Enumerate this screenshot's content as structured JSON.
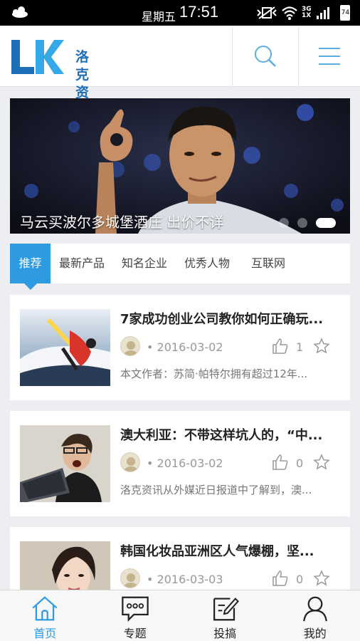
{
  "status_bar": {
    "day": "星期五",
    "time": "17:51",
    "network": [
      "3G",
      "1X"
    ],
    "battery": "74"
  },
  "header": {
    "logo_text": [
      "洛克",
      "资讯"
    ]
  },
  "banner": {
    "caption": "马云买波尔多城堡酒庄 出价不详"
  },
  "tabs": [
    "推荐",
    "最新产品",
    "知名企业",
    "优秀人物",
    "互联网"
  ],
  "articles": [
    {
      "title": "7家成功创业公司教你如何正确玩...",
      "date": "• 2016-03-02",
      "likes": "1",
      "excerpt": "本文作者：苏简·帕特尔拥有超过12年..."
    },
    {
      "title": "澳大利亚：不带这样坑人的，“中...",
      "date": "• 2016-03-02",
      "likes": "0",
      "excerpt": "洛克资讯从外媒近日报道中了解到，澳..."
    },
    {
      "title": "韩国化妆品亚洲区人气爆棚，坚...",
      "date": "• 2016-03-03",
      "likes": "0",
      "excerpt": ""
    }
  ],
  "bottom_nav": [
    "首页",
    "专题",
    "投搞",
    "我的"
  ],
  "colors": {
    "accent": "#2e9be0",
    "logo_blue": "#1e6fb8",
    "background": "#eceef1"
  }
}
